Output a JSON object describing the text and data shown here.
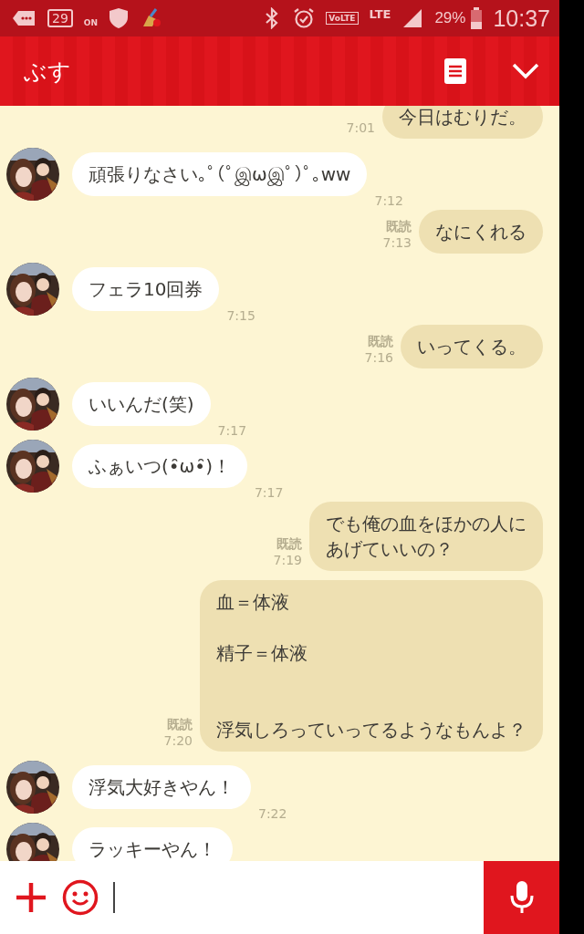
{
  "status_bar": {
    "date": "29",
    "hotspot": "ON",
    "volte": "VoLTE",
    "network": "LTE",
    "battery": "29%",
    "time": "10:37"
  },
  "header": {
    "title": "ぶす"
  },
  "messages": [
    {
      "kind": "sent",
      "text": "今日はむりだ。",
      "time": "7:01"
    },
    {
      "kind": "received",
      "text": "頑張りなさい｡ﾟ(ﾟஇωஇﾟ)ﾟ｡ww",
      "time": "7:12"
    },
    {
      "kind": "sent",
      "text": "なにくれる",
      "read": true,
      "read_label": "既読",
      "time": "7:13"
    },
    {
      "kind": "received",
      "text": "フェラ10回券",
      "time": "7:15"
    },
    {
      "kind": "sent",
      "text": "いってくる。",
      "read": true,
      "read_label": "既読",
      "time": "7:16"
    },
    {
      "kind": "received",
      "text": "いいんだ(笑)",
      "time": "7:17"
    },
    {
      "kind": "received",
      "text": "ふぁいつ(•̑ω•̑)！",
      "time": "7:17"
    },
    {
      "kind": "sent",
      "lines": [
        {
          "kind": "text",
          "text": "でも俺の血をほかの人に"
        },
        {
          "kind": "text",
          "text": "あげていいの？"
        }
      ],
      "read": true,
      "read_label": "既読",
      "time": "7:19"
    },
    {
      "kind": "sent",
      "lines": [
        {
          "kind": "text",
          "text": "血＝体液"
        },
        {
          "kind": "blank"
        },
        {
          "kind": "text",
          "text": "精子＝体液"
        },
        {
          "kind": "blank"
        },
        {
          "kind": "blank"
        },
        {
          "kind": "text",
          "text": "浮気しろっていってるようなもんよ？"
        }
      ],
      "read": true,
      "read_label": "既読",
      "time": "7:20"
    },
    {
      "kind": "received",
      "text": "浮気大好きやん！",
      "time": "7:22"
    },
    {
      "kind": "received",
      "text": "ラッキーやん！"
    }
  ]
}
